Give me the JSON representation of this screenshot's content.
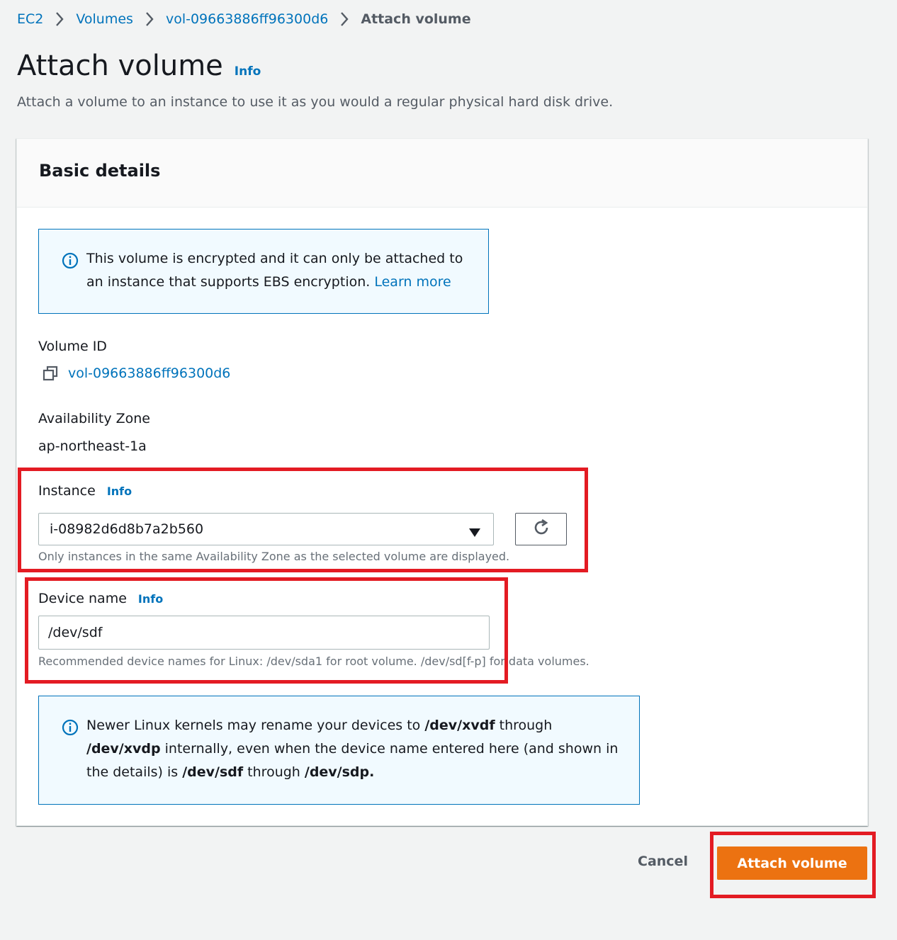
{
  "breadcrumb": {
    "items": [
      "EC2",
      "Volumes",
      "vol-09663886ff96300d6",
      "Attach volume"
    ]
  },
  "header": {
    "title": "Attach volume",
    "info": "Info",
    "description": "Attach a volume to an instance to use it as you would a regular physical hard disk drive."
  },
  "basic_details": {
    "title": "Basic details",
    "encryption_alert": {
      "line1": "This volume is encrypted and it can only be attached to",
      "line2": "an instance that supports EBS encryption.",
      "learn_more": "Learn more"
    },
    "volume_id": {
      "label": "Volume ID",
      "value": "vol-09663886ff96300d6"
    },
    "availability_zone": {
      "label": "Availability Zone",
      "value": "ap-northeast-1a"
    },
    "instance": {
      "label": "Instance",
      "info": "Info",
      "selected": "i-08982d6d8b7a2b560",
      "hint": "Only instances in the same Availability Zone as the selected volume are displayed."
    },
    "device_name": {
      "label": "Device name",
      "info": "Info",
      "value": "/dev/sdf",
      "hint": "Recommended device names for Linux: /dev/sda1 for root volume. /dev/sd[f-p] for data volumes."
    },
    "kernel_alert": {
      "p1": "Newer Linux kernels may rename your devices to ",
      "b1": "/dev/xvdf",
      "p2": " through",
      "b2": "/dev/xvdp",
      "p3": " internally, even when the device name entered here (and shown in",
      "p4": "the details) is ",
      "b3": "/dev/sdf",
      "p5": " through ",
      "b4": "/dev/sdp."
    }
  },
  "actions": {
    "cancel": "Cancel",
    "attach": "Attach volume"
  },
  "colors": {
    "link": "#0073bb",
    "primary": "#ec7211",
    "highlight": "#e31b23",
    "alert_bg": "#f1faff"
  },
  "icons": [
    "chevron-right-icon",
    "info-circle-icon",
    "copy-icon",
    "caret-down-icon",
    "refresh-icon"
  ]
}
